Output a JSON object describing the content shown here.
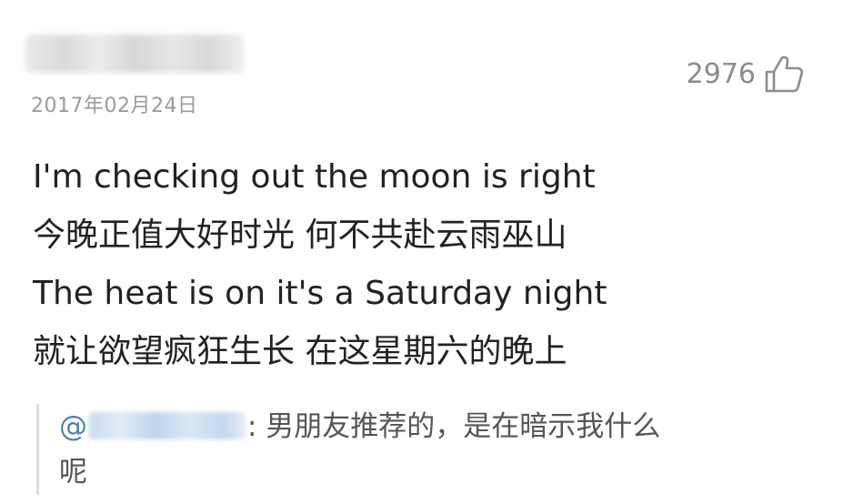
{
  "comment": {
    "date": "2017年02月24日",
    "likes": "2976",
    "lines": [
      "I'm checking out the moon is right",
      "今晚正值大好时光 何不共赴云雨巫山",
      "The heat is on it's a Saturday night",
      "就让欲望疯狂生长 在这星期六的晚上"
    ]
  },
  "reply": {
    "at_symbol": "@",
    "text_line1": ": 男朋友推荐的，是在暗示我什么",
    "text_line2": "呢"
  },
  "colors": {
    "accent_link": "#4c7fb5",
    "body_text": "#222222",
    "muted_text": "#9a9a9a"
  },
  "icons": {
    "like": "thumbs-up-icon"
  }
}
